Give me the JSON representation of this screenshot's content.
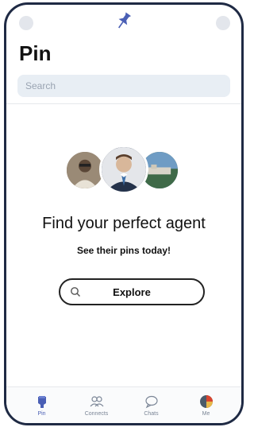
{
  "app": {
    "title": "Pin",
    "logo_icon": "pin-icon",
    "brand_color": "#4a5fb5"
  },
  "search": {
    "placeholder": "Search"
  },
  "hero": {
    "headline": "Find your perfect agent",
    "subheadline": "See their pins today!",
    "explore_label": "Explore"
  },
  "tabs": [
    {
      "label": "Pin",
      "icon": "pin-icon",
      "active": true
    },
    {
      "label": "Connects",
      "icon": "people-icon",
      "active": false
    },
    {
      "label": "Chats",
      "icon": "chat-icon",
      "active": false
    },
    {
      "label": "Me",
      "icon": "profile-icon",
      "active": false
    }
  ]
}
